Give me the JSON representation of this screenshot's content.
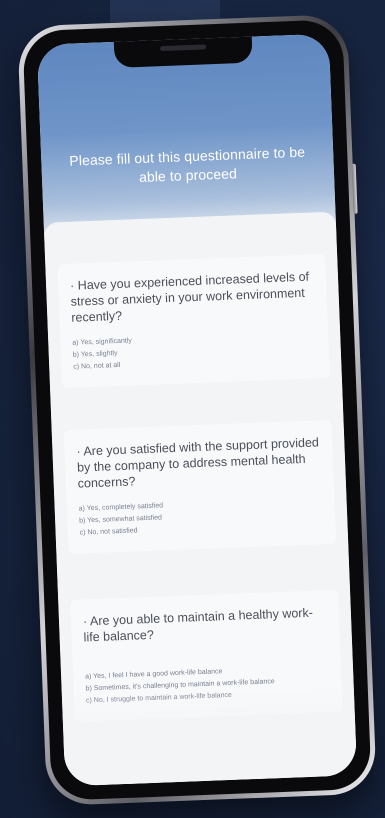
{
  "header": {
    "title": "Please fill out this questionnaire to be able to proceed"
  },
  "questions": [
    {
      "text": "· Have you experienced increased levels of stress or anxiety in your work environment recently?",
      "options": [
        "a) Yes, significantly",
        "b) Yes, slightly",
        "c) No, not at all"
      ]
    },
    {
      "text": "· Are you satisfied with the support provided by the company to address mental health concerns?",
      "options": [
        "a) Yes, completely satisfied",
        "b) Yes, somewhat satisfied",
        "c) No, not satisfied"
      ]
    },
    {
      "text": "· Are you able to maintain a healthy work-life balance?",
      "options": [
        "a) Yes, I feel I have a good work-life balance",
        "b) Sometimes, it's challenging to maintain a work-life balance",
        "c) No, I struggle to maintain a work-life balance"
      ]
    }
  ],
  "colors": {
    "background": "#17243f",
    "header_blue": "#6f95c8",
    "card": "#f8f9fb"
  }
}
